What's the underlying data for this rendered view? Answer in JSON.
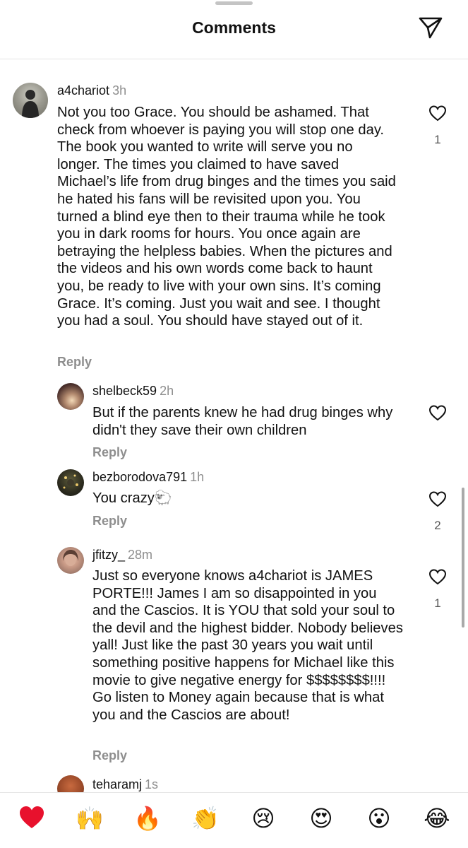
{
  "header": {
    "title": "Comments"
  },
  "comments": [
    {
      "username": "a4chariot",
      "time": "3h",
      "text": "Not you too Grace.  You should be ashamed. That check from whoever is paying you will stop one day.  The book you wanted to write will serve you no longer.  The times you claimed to have saved Michael’s life from drug binges and the times you said he hated his fans will be revisited upon you.  You turned  a blind eye then to their trauma while he took you in dark rooms for hours. You once again are betraying the helpless babies. When the pictures and the videos and his own words come back to haunt you, be ready to live with your own sins.  It’s coming Grace.  It’s coming.  Just you wait and see.  I thought you had a soul.  You should have stayed out of it.",
      "reply_label": "Reply",
      "likes": "1"
    },
    {
      "username": "shelbeck59",
      "time": "2h",
      "text": "But if the parents knew he had drug binges why didn't they save their own children",
      "reply_label": "Reply",
      "likes": ""
    },
    {
      "username": "bezborodova791",
      "time": "1h",
      "text": "You crazy",
      "emoji": "🐑",
      "reply_label": "Reply",
      "likes": "2"
    },
    {
      "username": "jfitzy_",
      "time": "28m",
      "text": "Just so everyone knows a4chariot is JAMES PORTE!!! James I am so disappointed in you and the Cascios.  It is YOU that sold your soul to the devil and the highest bidder. Nobody believes yall!  Just like the past 30 years you wait until something positive happens for Michael like this movie to give negative energy for $$$$$$$$!!!! Go listen to Money again because that is what you and the Cascios are about!",
      "reply_label": "Reply",
      "likes": "1"
    },
    {
      "username": "teharamj",
      "time": "1s"
    }
  ],
  "emoji_bar": [
    {
      "name": "red-heart",
      "glyph": "❤️"
    },
    {
      "name": "raising-hands",
      "glyph": "🙌"
    },
    {
      "name": "fire",
      "glyph": "🔥"
    },
    {
      "name": "clapping-hands",
      "glyph": "👏"
    },
    {
      "name": "crying-face",
      "glyph": "😢"
    },
    {
      "name": "heart-eyes",
      "glyph": "😍"
    },
    {
      "name": "surprised-face",
      "glyph": "😮"
    },
    {
      "name": "tears-of-joy",
      "glyph": "😂"
    }
  ],
  "colors": {
    "text": "#111111",
    "secondary": "#8e8e8e",
    "divider": "#e3e3e3"
  },
  "icons": {
    "share": "paper-plane-icon",
    "like": "heart-outline-icon"
  }
}
